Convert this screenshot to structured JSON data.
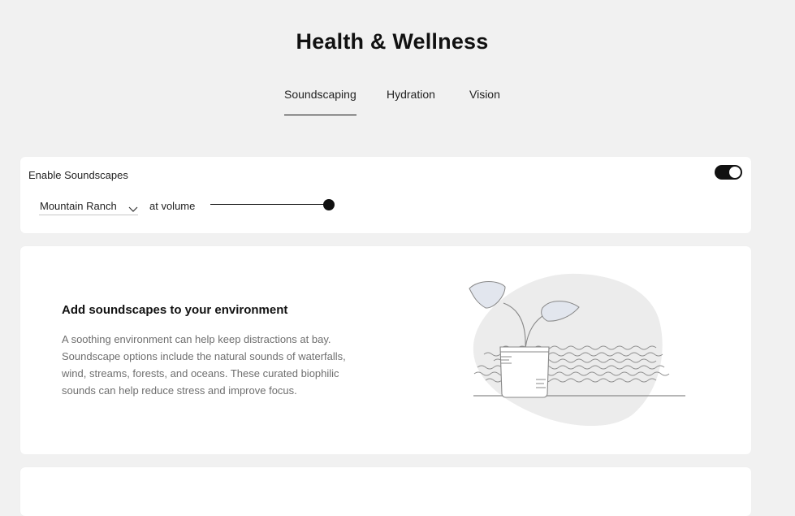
{
  "page": {
    "title": "Health & Wellness"
  },
  "tabs": [
    {
      "label": "Soundscaping",
      "active": true
    },
    {
      "label": "Hydration",
      "active": false
    },
    {
      "label": "Vision",
      "active": false
    }
  ],
  "settings": {
    "enable_label": "Enable Soundscapes",
    "toggle_on": true,
    "soundscape_selected": "Mountain Ranch",
    "volume_label": "at volume",
    "volume_fraction": 1.0
  },
  "info": {
    "title": "Add soundscapes to your environment",
    "body": "A soothing environment can help keep distractions at bay. Soundscape options include the natural sounds of waterfalls, wind, streams, forests, and oceans. These curated biophilic sounds can help reduce stress and improve focus.",
    "illustration": "plant-soundwaves-illustration"
  },
  "colors": {
    "background": "#f1f1f1",
    "card": "#ffffff",
    "accent": "#111111",
    "body_text": "#6f6f6f"
  }
}
